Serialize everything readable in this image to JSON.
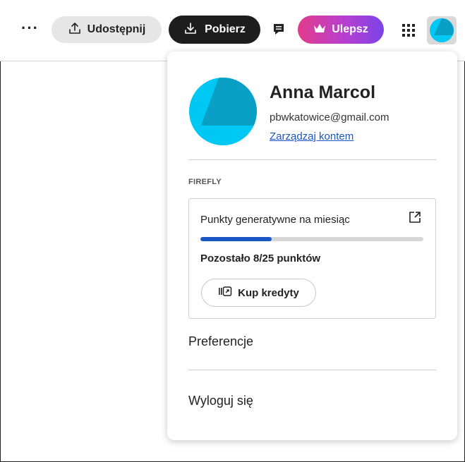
{
  "topbar": {
    "more_label": "···",
    "share_label": "Udostępnij",
    "download_label": "Pobierz",
    "upgrade_label": "Ulepsz",
    "icons": [
      "share-icon",
      "download-icon",
      "comment-icon",
      "crown-icon",
      "apps-grid-icon",
      "avatar"
    ]
  },
  "profile": {
    "name": "Anna Marcol",
    "email": "pbwkatowice@gmail.com",
    "manage_link": "Zarządzaj kontem"
  },
  "firefly": {
    "section_label": "FIREFLY",
    "credits_title": "Punkty generatywne na miesiąc",
    "progress_fraction": 0.32,
    "remaining_text": "Pozostało 8/25 punktów",
    "buy_label": "Kup kredyty"
  },
  "menu": {
    "preferences": "Preferencje",
    "logout": "Wyloguj się"
  },
  "colors": {
    "accent_blue": "#1a56c4",
    "avatar_cyan": "#00c8f5",
    "avatar_dark": "#0a9fc4",
    "upgrade_gradient": [
      "#e23c8b",
      "#7a44e8"
    ]
  }
}
